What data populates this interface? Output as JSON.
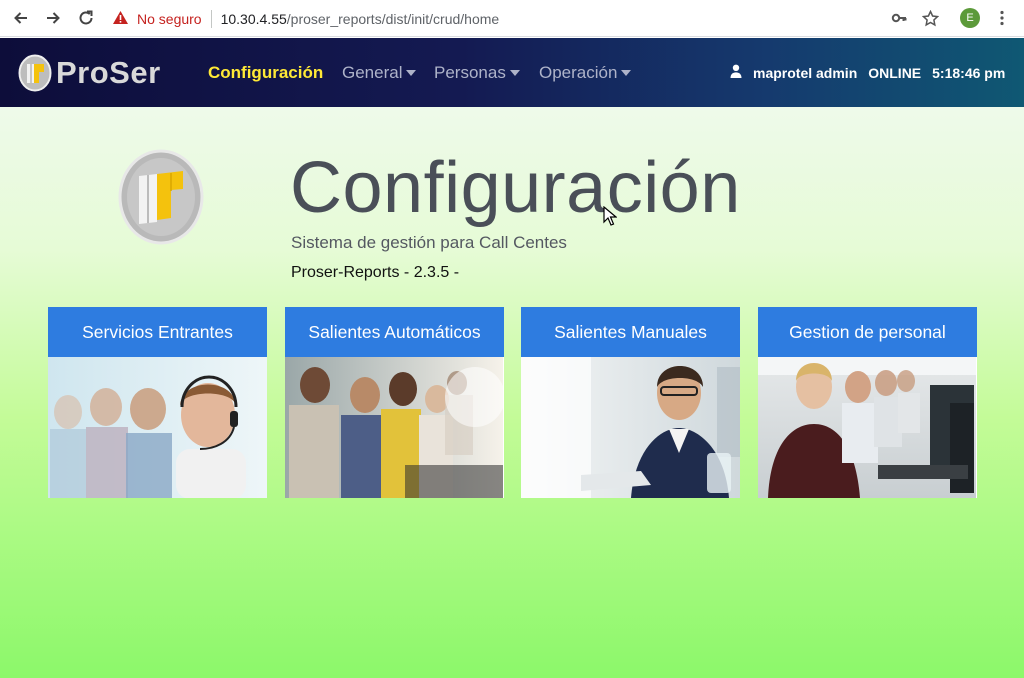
{
  "browser": {
    "security_label": "No seguro",
    "url_host": "10.30.4.55",
    "url_path": "/proser_reports/dist/init/crud/home",
    "profile_initial": "E"
  },
  "navbar": {
    "brand": "ProSer",
    "active_item": "Configuración",
    "menus": [
      "General",
      "Personas",
      "Operación"
    ],
    "user_name": "maprotel admin",
    "status": "ONLINE",
    "time": "5:18:46 pm"
  },
  "hero": {
    "title": "Configuración",
    "subtitle": "Sistema de gestión para Call Centes",
    "version": "Proser-Reports - 2.3.5 -"
  },
  "cards": [
    {
      "label": "Servicios Entrantes"
    },
    {
      "label": "Salientes Automáticos"
    },
    {
      "label": "Salientes Manuales"
    },
    {
      "label": "Gestion de personal"
    }
  ],
  "colors": {
    "navbar_start": "#0d0d3a",
    "navbar_end": "#0f5873",
    "accent_yellow": "#ffe936",
    "card_header": "#2e7ce0"
  }
}
